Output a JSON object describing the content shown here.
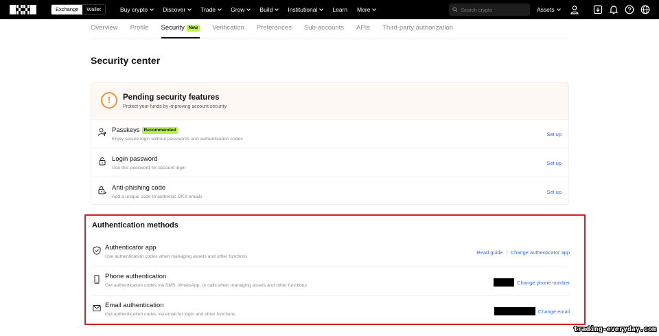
{
  "topbar": {
    "mode_exchange": "Exchange",
    "mode_wallet": "Wallet",
    "nav": [
      "Buy crypto",
      "Discover",
      "Trade",
      "Grow",
      "Build",
      "Institutional",
      "Learn",
      "More"
    ],
    "nav_has_chevron": [
      true,
      true,
      true,
      true,
      true,
      true,
      false,
      true
    ],
    "search_placeholder": "Search crypto",
    "assets_label": "Assets",
    "icons": [
      "user-icon",
      "download-icon",
      "bell-icon",
      "help-icon",
      "globe-icon"
    ]
  },
  "tabs": {
    "items": [
      "Overview",
      "Profile",
      "Security",
      "Verification",
      "Preferences",
      "Sub-accounts",
      "APIs",
      "Third-party authorization"
    ],
    "active": "Security",
    "new_badge": "New"
  },
  "page_title": "Security center",
  "pending": {
    "title": "Pending security features",
    "subtitle": "Protect your funds by improving account security",
    "items": [
      {
        "icon": "passkey-icon",
        "title": "Passkeys",
        "badge": "Recommended",
        "desc": "Enjoy secure login without passwords and authentication codes",
        "action": "Set up"
      },
      {
        "icon": "lock-icon",
        "title": "Login password",
        "desc": "Use this password for account login",
        "action": "Set up"
      },
      {
        "icon": "anti-phishing-icon",
        "title": "Anti-phishing code",
        "desc": "Add a unique code to authentic OKX emails",
        "action": "Set up"
      }
    ]
  },
  "auth": {
    "title": "Authentication methods",
    "items": [
      {
        "icon": "shield-icon",
        "title": "Authenticator app",
        "desc": "Use authentication codes when managing assets and other functions",
        "action1": "Read guide",
        "action2": "Change authenticator app"
      },
      {
        "icon": "phone-icon",
        "title": "Phone authentication",
        "desc": "Get authentication codes via SMS, WhatsApp, or calls when managing assets and other functions",
        "action": "Change phone number"
      },
      {
        "icon": "mail-icon",
        "title": "Email authentication",
        "desc": "Get authentication codes via email for login and other functions",
        "action": "Change email"
      }
    ]
  },
  "colors": {
    "accent_link": "#3a6fd8",
    "badge": "#b8f24a",
    "warning": "#f29436",
    "highlight_border": "#d71f27"
  },
  "watermark": "trading-everyday.com"
}
